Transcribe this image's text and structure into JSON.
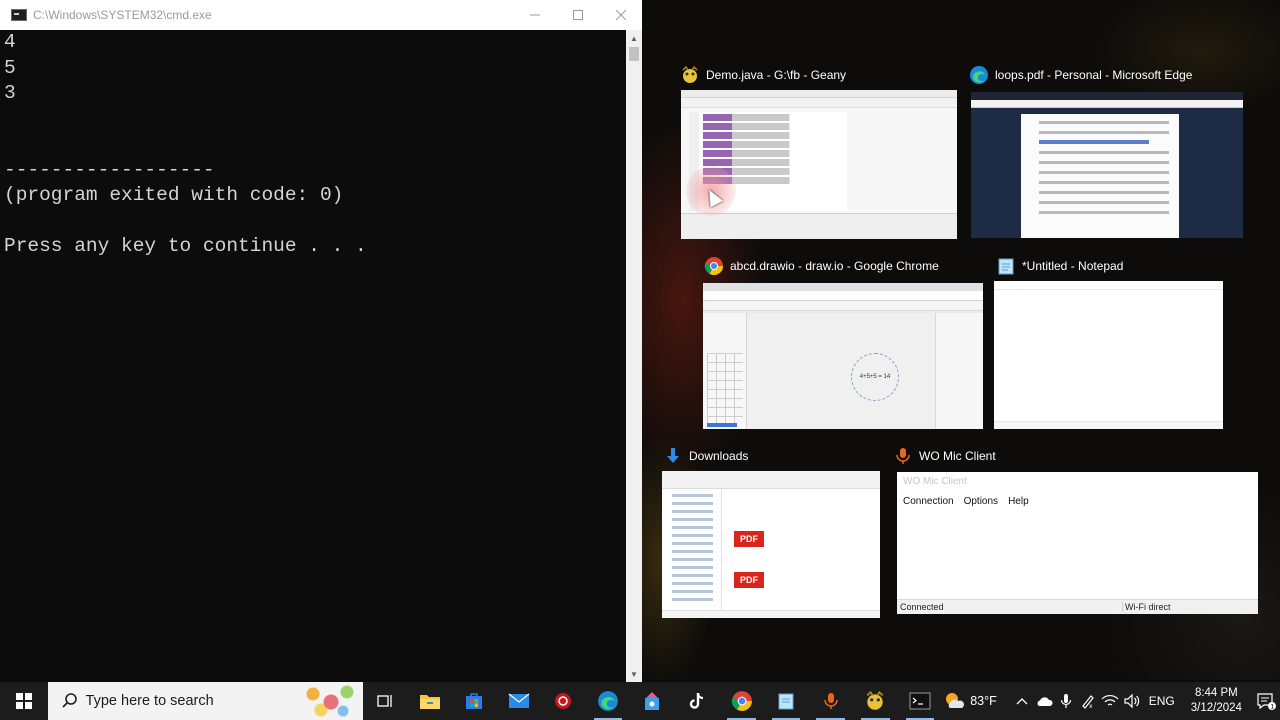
{
  "cmd": {
    "title": "C:\\Windows\\SYSTEM32\\cmd.exe",
    "lines": [
      "4",
      "5",
      "3",
      "",
      "",
      "------------------",
      "(program exited with code: 0)",
      "",
      "Press any key to continue . . ."
    ]
  },
  "task_view": {
    "items": [
      {
        "title": "Demo.java - G:\\fb - Geany",
        "icon": "geany-icon"
      },
      {
        "title": "loops.pdf - Personal - Microsoft Edge",
        "icon": "edge-icon"
      },
      {
        "title": "abcd.drawio - draw.io - Google Chrome",
        "icon": "chrome-icon"
      },
      {
        "title": "*Untitled - Notepad",
        "icon": "notepad-icon"
      },
      {
        "title": "Downloads",
        "icon": "downloads-icon"
      },
      {
        "title": "WO Mic Client",
        "icon": "microphone-icon"
      }
    ],
    "drawio_shape_text": "4+5+5 = 14",
    "pdf_label": "PDF",
    "womic": {
      "window_title": "WO Mic Client",
      "menu": [
        "Connection",
        "Options",
        "Help"
      ],
      "status_left": "Connected",
      "status_right": "Wi-Fi direct"
    }
  },
  "taskbar": {
    "search_placeholder": "Type here to search",
    "pinned": [
      "task-view-icon",
      "file-explorer-icon",
      "store-icon",
      "mail-icon",
      "antivirus-icon",
      "edge-icon",
      "winget-icon",
      "tiktok-icon",
      "chrome-icon",
      "notepad-icon",
      "microphone-icon",
      "geany-icon",
      "cmd-icon"
    ],
    "weather": "83°F",
    "language": "ENG",
    "time": "8:44 PM",
    "date": "3/12/2024",
    "notification_count": "1"
  }
}
